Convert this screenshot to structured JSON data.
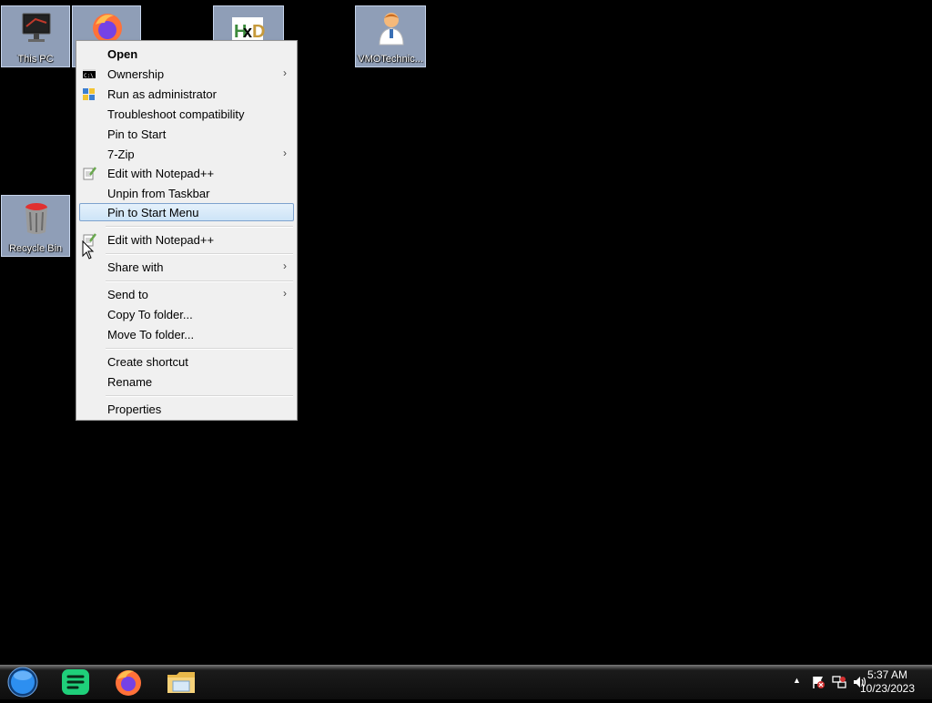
{
  "desktop": {
    "icons": [
      {
        "label": "This PC",
        "icon": "computer-icon"
      },
      {
        "label": "",
        "icon": "firefox-icon"
      },
      {
        "label": "",
        "icon": "hxd-icon"
      },
      {
        "label": "VMOTechnic...",
        "icon": "doctor-icon"
      },
      {
        "label": "Recycle Bin",
        "icon": "recycle-bin-icon"
      }
    ]
  },
  "context_menu": {
    "items": [
      {
        "label": "Open",
        "bold": true
      },
      {
        "label": "Ownership",
        "submenu": true,
        "icon": "console-icon"
      },
      {
        "label": "Run as administrator",
        "icon": "shield-icon"
      },
      {
        "label": "Troubleshoot compatibility"
      },
      {
        "label": "Pin to Start"
      },
      {
        "label": "7-Zip",
        "submenu": true
      },
      {
        "label": "Edit with Notepad++",
        "icon": "notepad-plus-icon"
      },
      {
        "label": "Unpin from Taskbar"
      },
      {
        "label": "Pin to Start Menu",
        "highlighted": true
      },
      {
        "label": "Edit with Notepad++",
        "icon": "notepad-plus-icon"
      },
      {
        "label": "Share with",
        "submenu": true
      },
      {
        "label": "Send to",
        "submenu": true
      },
      {
        "label": "Copy To folder..."
      },
      {
        "label": "Move To folder..."
      },
      {
        "label": "Create shortcut"
      },
      {
        "label": "Rename"
      },
      {
        "label": "Properties"
      }
    ],
    "submenu_arrow": "›"
  },
  "taskbar": {
    "buttons": [
      {
        "name": "start-button",
        "icon": "start-orb-icon"
      },
      {
        "name": "taskbar-notes-app",
        "icon": "notes-icon"
      },
      {
        "name": "taskbar-firefox",
        "icon": "firefox-icon"
      },
      {
        "name": "taskbar-file-explorer",
        "icon": "folder-icon"
      }
    ],
    "tray": {
      "overflow_arrow": "▲",
      "time": "5:37 AM",
      "date": "10/23/2023"
    }
  },
  "colors": {
    "desktop_bg": "#000000",
    "menu_bg": "#f0f0f0",
    "highlight_border": "#7da2ce"
  }
}
